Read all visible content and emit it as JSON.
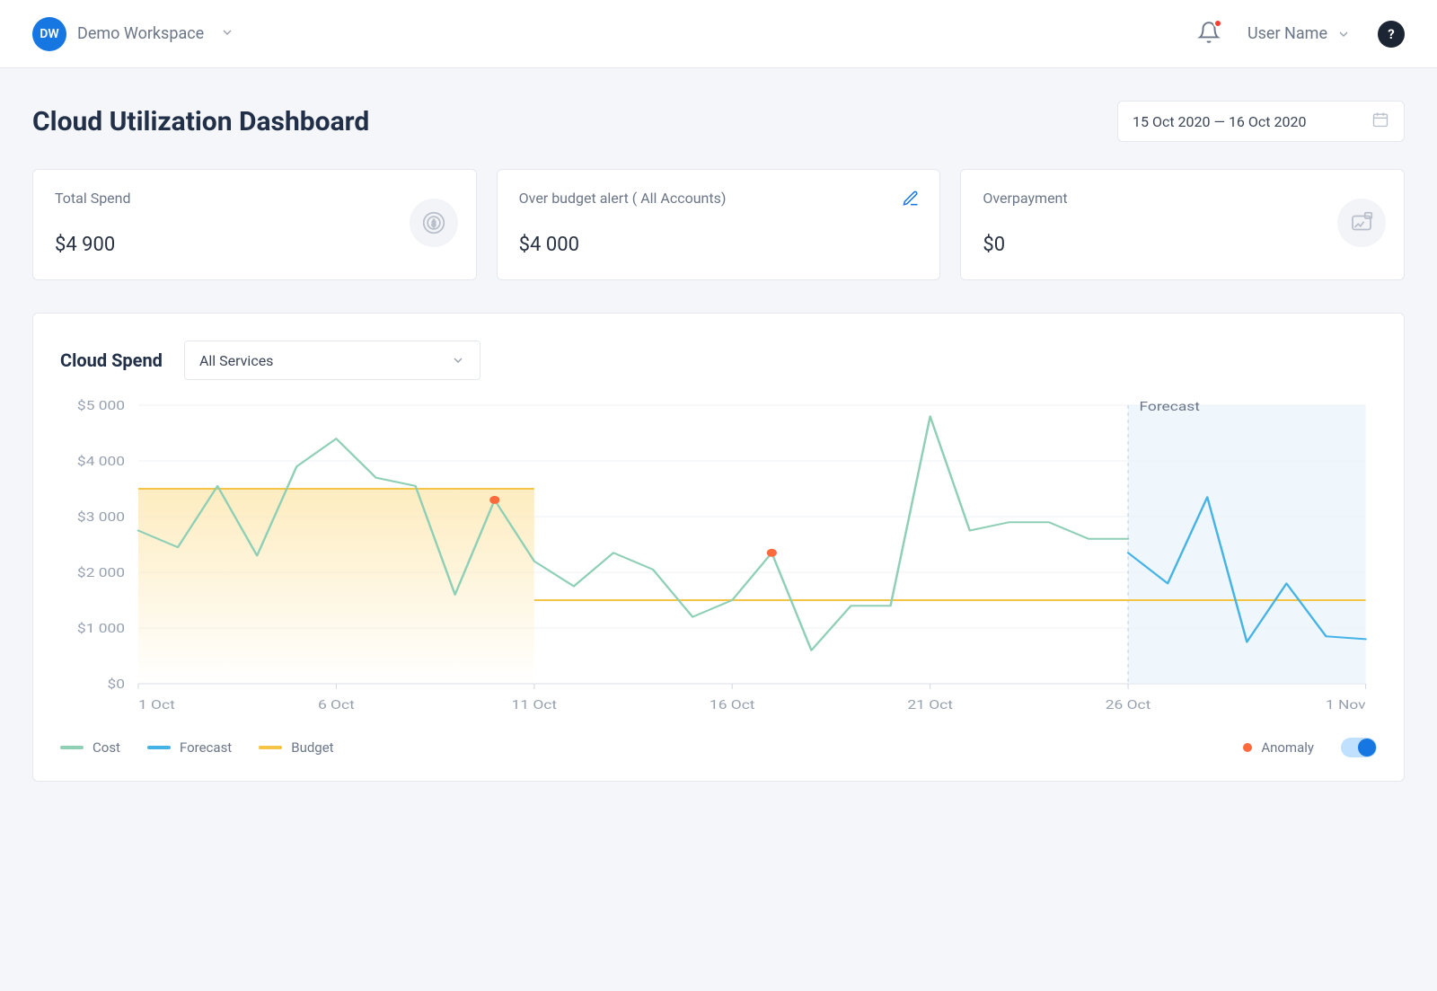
{
  "topbar": {
    "workspace_initials": "DW",
    "workspace_name": "Demo Workspace",
    "user_name": "User Name"
  },
  "header": {
    "title": "Cloud Utilization Dashboard",
    "date_range": "15 Oct 2020 — 16 Oct 2020"
  },
  "metrics": {
    "total_spend": {
      "label": "Total Spend",
      "value": "$4 900"
    },
    "over_budget": {
      "label": "Over budget alert ( All Accounts)",
      "value": "$4 000"
    },
    "overpayment": {
      "label": "Overpayment",
      "value": "$0"
    }
  },
  "chart": {
    "title": "Cloud Spend",
    "selector_value": "All Services",
    "forecast_label": "Forecast",
    "legend": {
      "cost": "Cost",
      "forecast": "Forecast",
      "budget": "Budget",
      "anomaly": "Anomaly"
    }
  },
  "chart_data": {
    "type": "line",
    "xlabel": "",
    "ylabel": "",
    "ylim": [
      0,
      5000
    ],
    "x_ticks": [
      "1 Oct",
      "6 Oct",
      "11 Oct",
      "16 Oct",
      "21 Oct",
      "26 Oct",
      "1 Nov"
    ],
    "y_ticks": [
      "$0",
      "$1 000",
      "$2 000",
      "$3 000",
      "$4 000",
      "$5 000"
    ],
    "x": [
      1,
      2,
      3,
      4,
      5,
      6,
      7,
      8,
      9,
      10,
      11,
      12,
      13,
      14,
      15,
      16,
      17,
      18,
      19,
      20,
      21,
      22,
      23,
      24,
      25,
      26,
      27,
      28,
      29,
      30,
      31,
      32
    ],
    "series": [
      {
        "name": "Cost",
        "color": "#8ecfb6",
        "range": [
          1,
          26
        ],
        "values": [
          2750,
          2450,
          3550,
          2300,
          3900,
          4400,
          3700,
          3550,
          1600,
          3300,
          2200,
          1750,
          2350,
          2050,
          1200,
          1500,
          2350,
          600,
          1400,
          1400,
          4800,
          2750,
          2900,
          2900,
          2600,
          2600
        ]
      },
      {
        "name": "Forecast",
        "color": "#45b3e6",
        "range": [
          26,
          32
        ],
        "values": [
          2350,
          1800,
          3350,
          750,
          1800,
          850,
          800
        ]
      },
      {
        "name": "Budget",
        "color": "#f3c445",
        "segments": [
          {
            "range": [
              1,
              11
            ],
            "value": 3500
          },
          {
            "range": [
              11,
              32
            ],
            "value": 1500
          }
        ]
      }
    ],
    "anomalies": [
      {
        "x": 10,
        "y": 3300
      },
      {
        "x": 17,
        "y": 2350
      }
    ],
    "forecast_zone": {
      "start": 26,
      "end": 32
    },
    "budget_fill": {
      "range": [
        1,
        11
      ],
      "value": 3500
    }
  }
}
